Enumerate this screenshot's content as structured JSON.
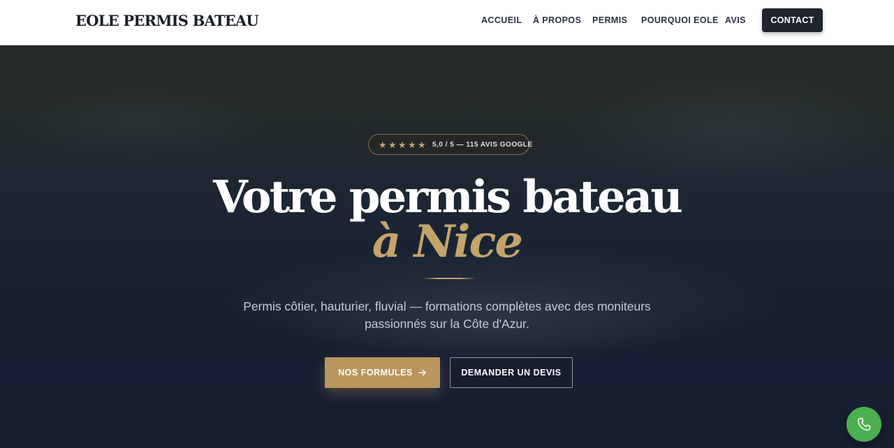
{
  "brand": {
    "logo_text": "EOLE PERMIS BATEAU"
  },
  "nav": {
    "items": [
      {
        "label": "ACCUEIL"
      },
      {
        "label": "À PROPOS"
      },
      {
        "label": "PERMIS"
      },
      {
        "label": "POURQUOI EOLE"
      },
      {
        "label": "AVIS"
      }
    ],
    "contact_label": "CONTACT"
  },
  "hero": {
    "rating_badge": "5,0 / 5 — 115 AVIS GOOGLE",
    "rating_stars": 5,
    "title_line1": "Votre permis bateau",
    "title_line2": "à Nice",
    "subtitle_line1": "Permis côtier, hauturier, fluvial — formations complètes avec des moniteurs",
    "subtitle_line2": "passionnés sur la Côte d'Azur.",
    "primary_button": "NOS FORMULES",
    "secondary_button": "DEMANDER UN DEVIS"
  },
  "colors": {
    "accent_gold": "#c3a46b",
    "button_gold": "#b9965e",
    "header_bg": "#ffffff",
    "contact_bg": "#1e232d",
    "phone_fab": "#4caf50"
  },
  "icons": {
    "star": "star-icon",
    "arrow": "arrow-right-icon",
    "phone": "phone-icon"
  }
}
